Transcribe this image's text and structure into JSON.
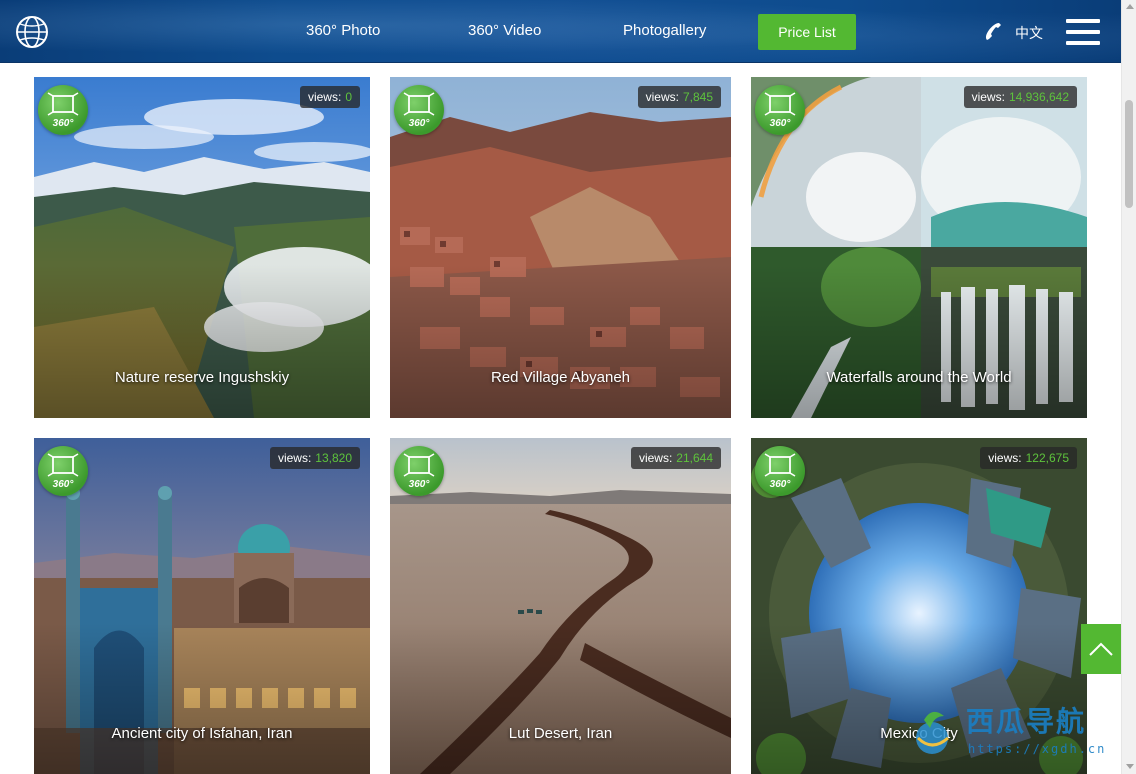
{
  "header": {
    "nav": [
      {
        "label": "360° Photo"
      },
      {
        "label": "360° Video"
      },
      {
        "label": "Photogallery"
      }
    ],
    "price_button": "Price List",
    "language": "中文",
    "icons": {
      "logo": "globe-icon",
      "phone": "phone-icon",
      "menu": "hamburger-menu-icon"
    }
  },
  "gallery": {
    "views_label": "views:",
    "badge_text": "360°",
    "cards": [
      {
        "title": "Nature reserve Ingushskiy",
        "views": "0"
      },
      {
        "title": "Red Village Abyaneh",
        "views": "7,845"
      },
      {
        "title": "Waterfalls around the World",
        "views": "14,936,642"
      },
      {
        "title": "Ancient city of Isfahan, Iran",
        "views": "13,820"
      },
      {
        "title": "Lut Desert, Iran",
        "views": "21,644"
      },
      {
        "title": "Mexico City",
        "views": "122,675"
      }
    ]
  },
  "watermark": {
    "text": "西瓜导航",
    "url": "https://xgdh.cn"
  },
  "colors": {
    "header_bg": "#0e4c8e",
    "accent_green": "#53b832",
    "views_number": "#5ec33c"
  }
}
